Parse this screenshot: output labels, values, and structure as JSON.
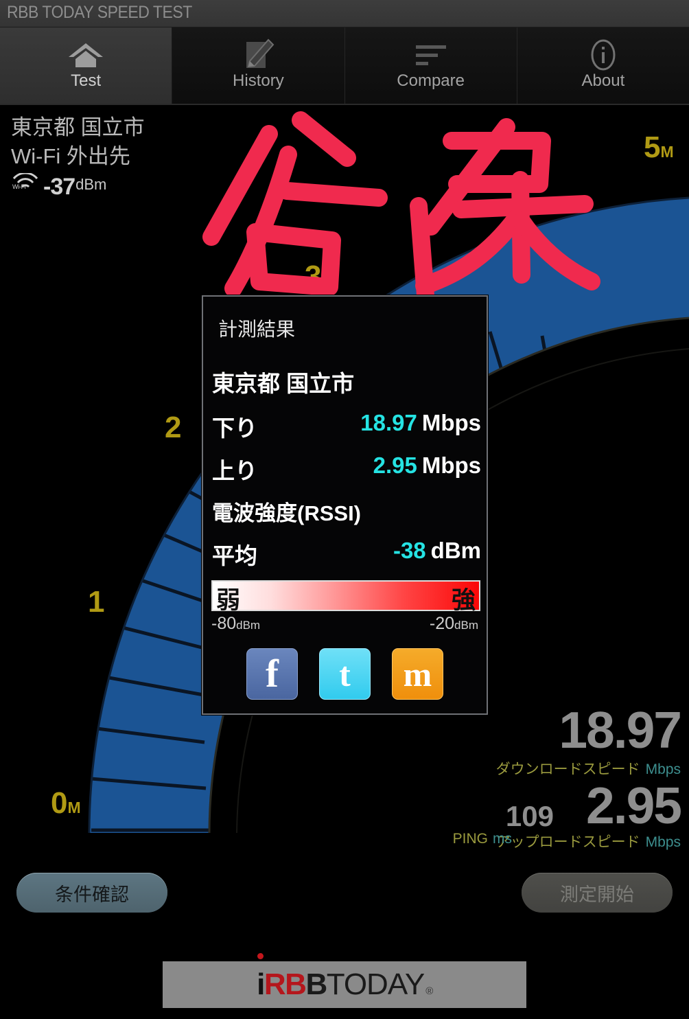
{
  "window": {
    "title": "RBB TODAY SPEED TEST"
  },
  "tabs": [
    {
      "label": "Test",
      "icon": "home-icon",
      "active": true
    },
    {
      "label": "History",
      "icon": "pencil-icon",
      "active": false
    },
    {
      "label": "Compare",
      "icon": "list-icon",
      "active": false
    },
    {
      "label": "About",
      "icon": "info-icon",
      "active": false
    }
  ],
  "location": {
    "region": "東京都 国立市",
    "network": "Wi-Fi 外出先",
    "wifi_icon_label": "Wi-Fi",
    "rssi_value": "-37",
    "rssi_unit": "dBm"
  },
  "gauge": {
    "labels": [
      {
        "text": "0",
        "suffix": "M"
      },
      {
        "text": "1",
        "suffix": ""
      },
      {
        "text": "2",
        "suffix": ""
      },
      {
        "text": "3",
        "suffix": ""
      },
      {
        "text": "5",
        "suffix": "M"
      }
    ],
    "fill_color": "#1b5494",
    "label_color": "#b09a14"
  },
  "annotation": {
    "text": "谷保",
    "color": "#f02a4e"
  },
  "dialog": {
    "title": "計測結果",
    "city": "東京都 国立市",
    "download": {
      "key": "下り",
      "value": "18.97",
      "unit": "Mbps"
    },
    "upload": {
      "key": "上り",
      "value": "2.95",
      "unit": "Mbps"
    },
    "rssi_section_label": "電波強度(RSSI)",
    "rssi_avg": {
      "key": "平均",
      "value": "-38",
      "unit": "dBm"
    },
    "scale": {
      "weak_label": "弱",
      "strong_label": "強",
      "min": "-80",
      "min_unit": "dBm",
      "max": "-20",
      "max_unit": "dBm"
    },
    "share": [
      {
        "name": "facebook-share-button",
        "glyph": "f"
      },
      {
        "name": "twitter-share-button",
        "glyph": "t"
      },
      {
        "name": "mixi-share-button",
        "glyph": "m"
      }
    ]
  },
  "readouts": {
    "download_value": "18.97",
    "download_caption": "ダウンロードスピード",
    "download_unit": "Mbps",
    "upload_value": "2.95",
    "upload_caption": "アップロードスピード",
    "upload_unit": "Mbps",
    "ping_value": "109",
    "ping_caption": "PING",
    "ping_unit": "ms"
  },
  "buttons": {
    "check_conditions": "条件確認",
    "start_measure": "測定開始"
  },
  "footer": {
    "logo_i": "i",
    "logo_rbb": "RB",
    "logo_b": "B",
    "logo_today": "TODAY",
    "logo_reg": "®"
  }
}
